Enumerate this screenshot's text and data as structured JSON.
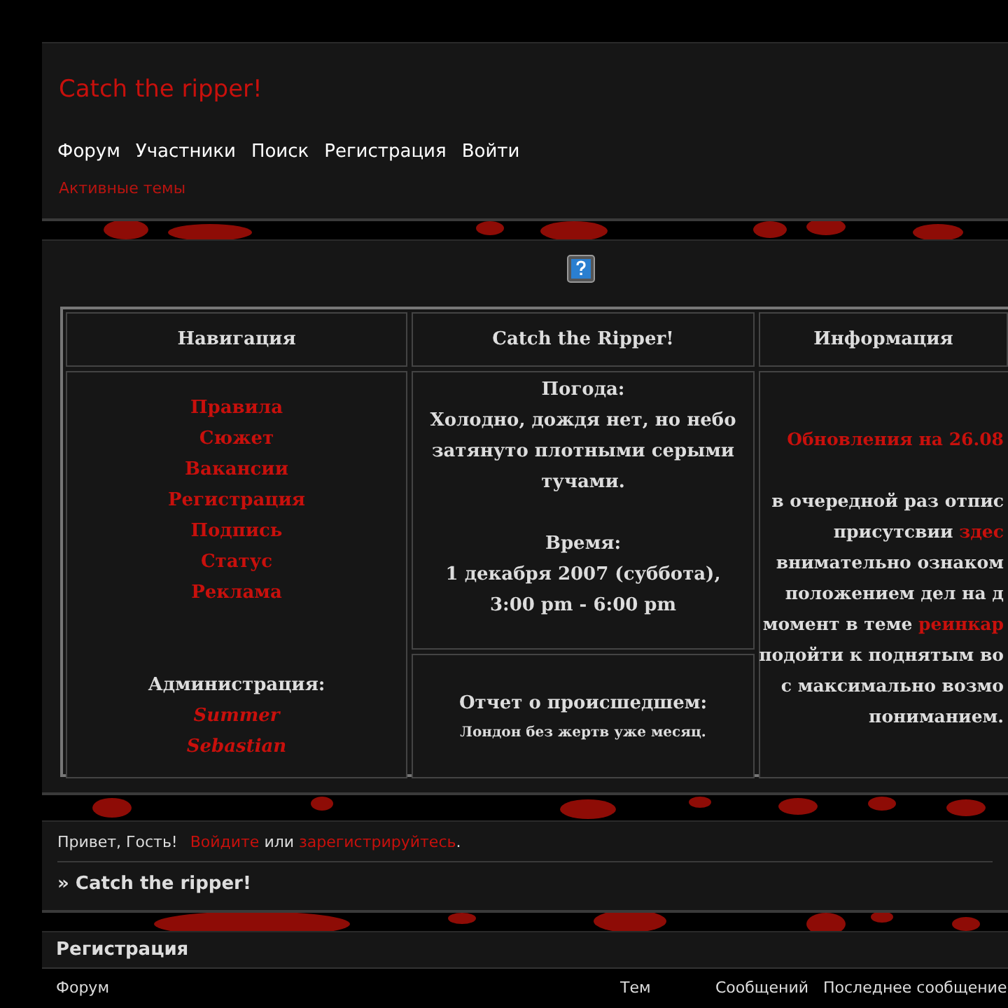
{
  "site_title": "Catch the ripper!",
  "nav": [
    "Форум",
    "Участники",
    "Поиск",
    "Регистрация",
    "Войти"
  ],
  "active_topics_link": "Активные темы",
  "info_table": {
    "headers": [
      "Навигация",
      "Catch the Ripper!",
      "Информация"
    ],
    "navigation_links": [
      "Правила",
      "Сюжет",
      "Вакансии",
      "Регистрация",
      "Подпись",
      "Статус",
      "Реклама"
    ],
    "admin_label": "Администрация:",
    "admins": [
      "Summer",
      "Sebastian"
    ],
    "weather": {
      "label": "Погода:",
      "text": "Холодно, дождя нет, но небо затянуто плотными серыми тучами."
    },
    "time": {
      "label": "Время:",
      "text": "1 декабря 2007 (суббота), 3:00 pm - 6:00 pm"
    },
    "report": {
      "title": "Отчет о происшедшем:",
      "text": "Лондон без жертв уже месяц."
    },
    "info_title": "Обновления на 26.08",
    "info_lines": [
      {
        "text": "в очередной раз отпис"
      },
      {
        "text": "присутсвии ",
        "link": "здес"
      },
      {
        "text": "внимательно ознаком"
      },
      {
        "text": "положением дел на д"
      },
      {
        "text": "момент в теме ",
        "link": "реинкар"
      },
      {
        "text": "подойти к поднятым во"
      },
      {
        "text": "с максимально возмо"
      },
      {
        "text": "пониманием."
      }
    ]
  },
  "welcome": {
    "greeting": "Привет, Гость!",
    "login_link": "Войдите",
    "or": "или",
    "register_link": "зарегистрируйтесь",
    "end": "."
  },
  "breadcrumb": "» Catch the ripper!",
  "category": {
    "title": "Регистрация",
    "columns": [
      "Форум",
      "Тем",
      "Сообщений",
      "Последнее сообщение"
    ]
  }
}
